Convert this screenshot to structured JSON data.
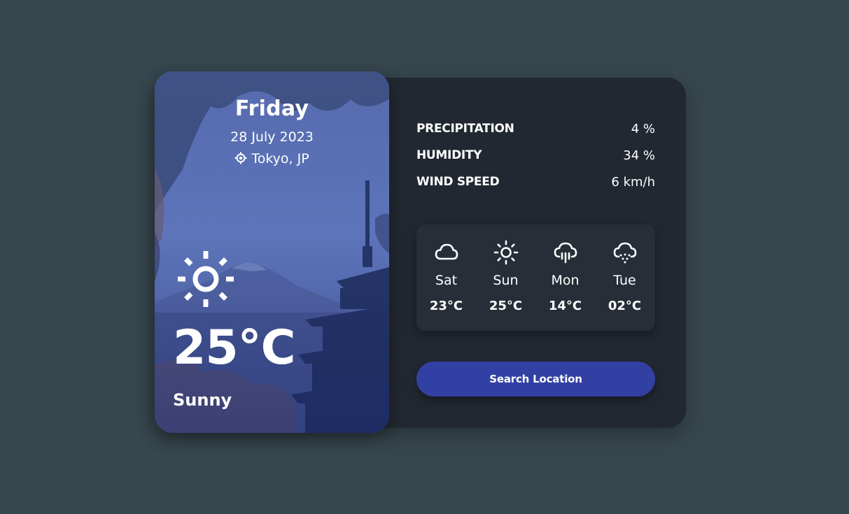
{
  "current": {
    "day": "Friday",
    "date": "28 July 2023",
    "location": "Tokyo, JP",
    "location_icon": "location-crosshair-icon",
    "weather_icon": "sun-icon",
    "temperature": "25°C",
    "condition": "Sunny"
  },
  "stats": [
    {
      "label": "PRECIPITATION",
      "value": "4 %"
    },
    {
      "label": "HUMIDITY",
      "value": "34 %"
    },
    {
      "label": "WIND SPEED",
      "value": "6 km/h"
    }
  ],
  "forecast": [
    {
      "day": "Sat",
      "temp": "23°C",
      "icon": "cloud-icon"
    },
    {
      "day": "Sun",
      "temp": "25°C",
      "icon": "sun-icon"
    },
    {
      "day": "Mon",
      "temp": "14°C",
      "icon": "cloud-rain-icon"
    },
    {
      "day": "Tue",
      "temp": "02°C",
      "icon": "cloud-snow-icon"
    }
  ],
  "search_button": {
    "label": "Search Location"
  },
  "colors": {
    "page_background": "#37474e",
    "panel_background": "#222831",
    "forecast_background": "#272e37",
    "button": "#3340a3",
    "text": "#ffffff"
  }
}
